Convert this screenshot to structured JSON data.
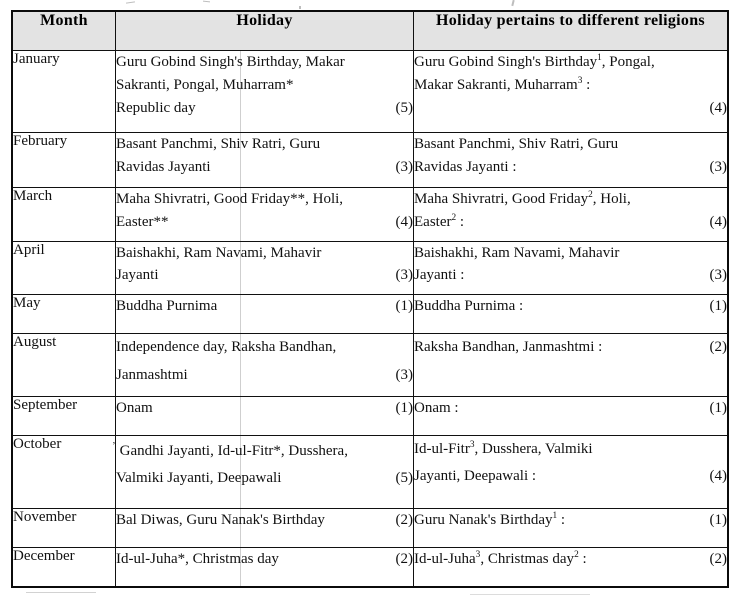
{
  "table": {
    "headers": {
      "month": "Month",
      "holiday": "Holiday",
      "religions": "Holiday pertains to different religions"
    },
    "rows": [
      {
        "month": "January",
        "holiday_lines": [
          "Guru Gobind Singh's Birthday, Makar",
          "Sakranti, Pongal, Muharram*",
          "Republic day"
        ],
        "holiday_count": "(5)",
        "religions_lines": [
          "Guru Gobind Singh's Birthday¹, Pongal,",
          "Makar Sakranti, Muharram³ :"
        ],
        "religions_count": "(4)"
      },
      {
        "month": "February",
        "holiday_lines": [
          "Basant Panchmi, Shiv Ratri, Guru",
          "Ravidas Jayanti"
        ],
        "holiday_count": "(3)",
        "religions_lines": [
          "Basant Panchmi, Shiv Ratri, Guru",
          "Ravidas Jayanti :"
        ],
        "religions_count": "(3)"
      },
      {
        "month": "March",
        "holiday_lines": [
          "Maha Shivratri, Good Friday**, Holi,",
          "Easter**"
        ],
        "holiday_count": "(4)",
        "religions_lines": [
          "Maha Shivratri, Good Friday², Holi,",
          "Easter² :"
        ],
        "religions_count": "(4)"
      },
      {
        "month": "April",
        "holiday_lines": [
          "Baishakhi, Ram Navami, Mahavir",
          "Jayanti"
        ],
        "holiday_count": "(3)",
        "religions_lines": [
          "Baishakhi, Ram Navami, Mahavir",
          "Jayanti :"
        ],
        "religions_count": "(3)"
      },
      {
        "month": "May",
        "holiday_lines": [
          "Buddha Purnima"
        ],
        "holiday_count": "(1)",
        "religions_lines": [
          "Buddha Purnima :"
        ],
        "religions_count": "(1)"
      },
      {
        "month": "August",
        "holiday_lines": [
          "Independence day, Raksha Bandhan,",
          "Janmashtmi"
        ],
        "holiday_count": "(3)",
        "religions_lines": [
          "Raksha Bandhan, Janmashtmi :"
        ],
        "religions_count": "(2)"
      },
      {
        "month": "September",
        "holiday_lines": [
          "Onam"
        ],
        "holiday_count": "(1)",
        "religions_lines": [
          "Onam :"
        ],
        "religions_count": "(1)"
      },
      {
        "month": "October",
        "holiday_lines": [
          "Gandhi Jayanti, Id-ul-Fitr*, Dusshera,",
          "Valmiki Jayanti, Deepawali"
        ],
        "holiday_count": "(5)",
        "religions_lines": [
          "Id-ul-Fitr³, Dusshera, Valmiki",
          "Jayanti, Deepawali :"
        ],
        "religions_count": "(4)"
      },
      {
        "month": "November",
        "holiday_lines": [
          "Bal Diwas, Guru Nanak's Birthday"
        ],
        "holiday_count": "(2)",
        "religions_lines": [
          "Guru Nanak's Birthday¹ :"
        ],
        "religions_count": "(1)"
      },
      {
        "month": "December",
        "holiday_lines": [
          "Id-ul-Juha*, Christmas day"
        ],
        "holiday_count": "(2)",
        "religions_lines": [
          "Id-ul-Juha³, Christmas day² :"
        ],
        "religions_count": "(2)"
      }
    ]
  }
}
